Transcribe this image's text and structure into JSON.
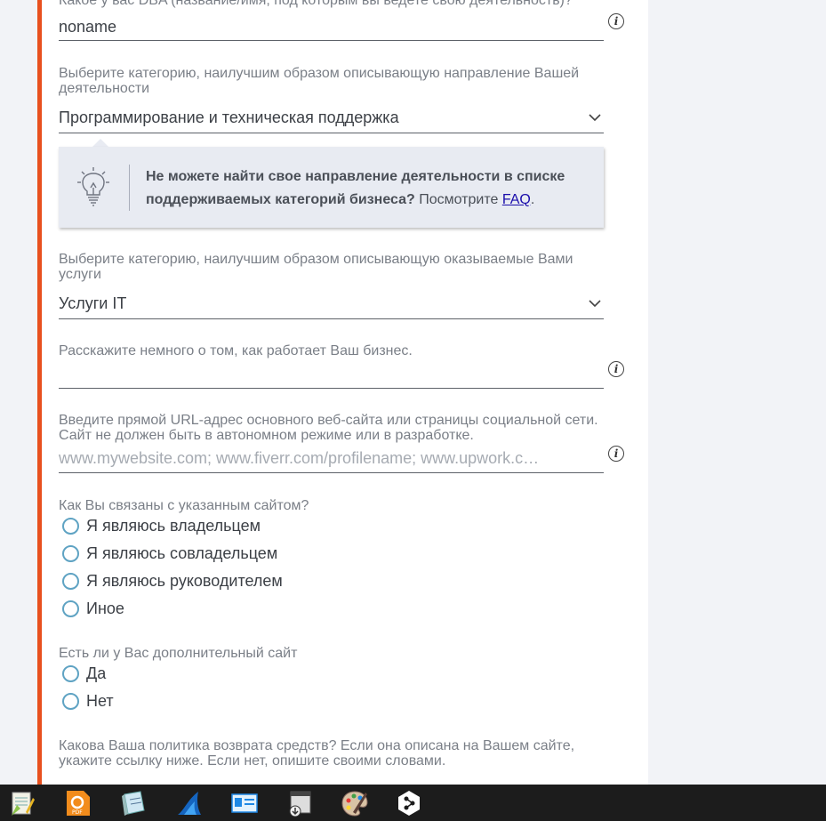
{
  "form": {
    "dba": {
      "label": "Какое у вас DBA (название/имя, под которым вы ведете свою деятельность)?",
      "value": "noname"
    },
    "business_category": {
      "label": "Выберите категорию, наилучшим образом описывающую направление Вашей деятельности",
      "value": "Программирование и техническая поддержка"
    },
    "tip": {
      "bold_text": "Не можете найти свое направление деятельности в списке поддерживаемых категорий бизнеса?",
      "text": " Посмотрите ",
      "link": "FAQ",
      "end": "."
    },
    "services_category": {
      "label": "Выберите категорию, наилучшим образом описывающую оказываемые Вами услуги",
      "value": "Услуги IT"
    },
    "business_description": {
      "label": "Расскажите немного о том, как работает Ваш бизнес.",
      "value": ""
    },
    "website": {
      "label": "Введите прямой URL-адрес основного веб-сайта или страницы социальной сети. Сайт не должен быть в автономном режиме или в разработке.",
      "placeholder": "www.mywebsite.com; www.fiverr.com/profilename; www.upwork.c…"
    },
    "relation": {
      "label": "Как Вы связаны с указанным сайтом?",
      "options": [
        "Я являюсь владельцем",
        "Я являюсь совладельцем",
        "Я являюсь руководителем",
        "Иное"
      ]
    },
    "additional_site": {
      "label": "Есть ли у Вас дополнительный сайт",
      "options": [
        "Да",
        "Нет"
      ]
    },
    "refund_policy": {
      "label": "Какова Ваша политика возврата средств? Если она описана на Вашем сайте, укажите ссылку ниже. Если нет, опишите своими словами."
    }
  },
  "colors": {
    "accent": "#e8501e",
    "radio": "#5fa3c3",
    "tip_bg": "#e8ebf2",
    "link": "#1a0dab"
  },
  "taskbar": {
    "icons": [
      "notepad-plus-icon",
      "pdf-app-icon",
      "notes-app-icon",
      "shark-app-icon",
      "id-card-icon",
      "installer-icon",
      "paint-palette-icon",
      "deepl-icon"
    ]
  }
}
